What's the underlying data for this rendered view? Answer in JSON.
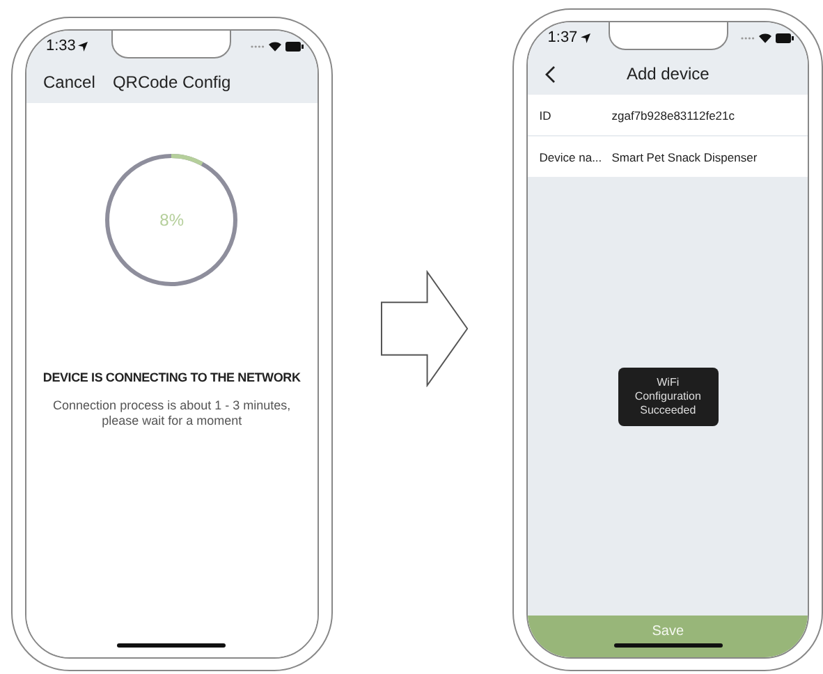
{
  "left_phone": {
    "status_time": "1:33",
    "nav": {
      "left": "Cancel",
      "title": "QRCode Config"
    },
    "progress": {
      "level": 0.08,
      "label": "8%"
    },
    "heading": "DEVICE IS CONNECTING TO THE NETWORK",
    "message": "Connection process is about 1 - 3 minutes, please wait for a moment"
  },
  "right_phone": {
    "status_time": "1:37",
    "nav": {
      "title": "Add device"
    },
    "fields": [
      {
        "label": "ID",
        "value": "zgaf7b928e83112fe21c"
      },
      {
        "label": "Device na...",
        "value": "Smart Pet Snack Dispenser"
      }
    ],
    "toast": "WiFi Configuration Succeeded",
    "save_button": {
      "label": "Save",
      "disabled": true
    }
  }
}
